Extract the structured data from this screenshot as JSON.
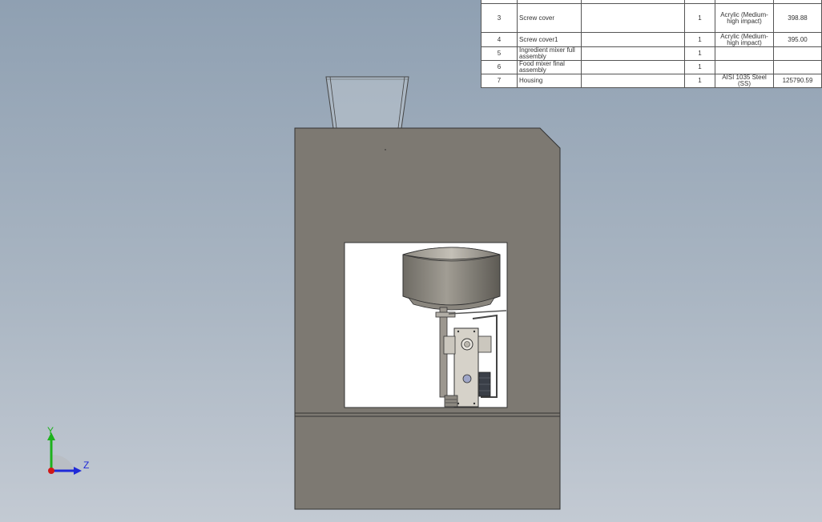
{
  "bom": {
    "rows": [
      {
        "item_no": "",
        "part": "",
        "description": "",
        "qty": "",
        "material": "",
        "mass": ""
      },
      {
        "item_no": "3",
        "part": "Screw cover",
        "description": "",
        "qty": "1",
        "material": "Acrylic (Medium-high impact)",
        "mass": "398.88"
      },
      {
        "item_no": "4",
        "part": "Screw cover1",
        "description": "",
        "qty": "1",
        "material": "Acrylic (Medium-high impact)",
        "mass": "395.00"
      },
      {
        "item_no": "5",
        "part": "Ingredient mixer full assembly",
        "description": "",
        "qty": "1",
        "material": "",
        "mass": ""
      },
      {
        "item_no": "6",
        "part": "Food mixer final assembly",
        "description": "",
        "qty": "1",
        "material": "",
        "mass": ""
      },
      {
        "item_no": "7",
        "part": "Housing",
        "description": "",
        "qty": "1",
        "material": "AISI 1035 Steel (SS)",
        "mass": "125790.59"
      }
    ]
  },
  "triad": {
    "y_label": "Y",
    "z_label": "Z",
    "y_color": "#1db11d",
    "z_color": "#1f2ad8",
    "x_color": "#d01818"
  },
  "colors": {
    "housing": "#7d7972",
    "housing_edge": "#333333",
    "window": "#ffffff",
    "hopper": "#bcc4cd"
  }
}
